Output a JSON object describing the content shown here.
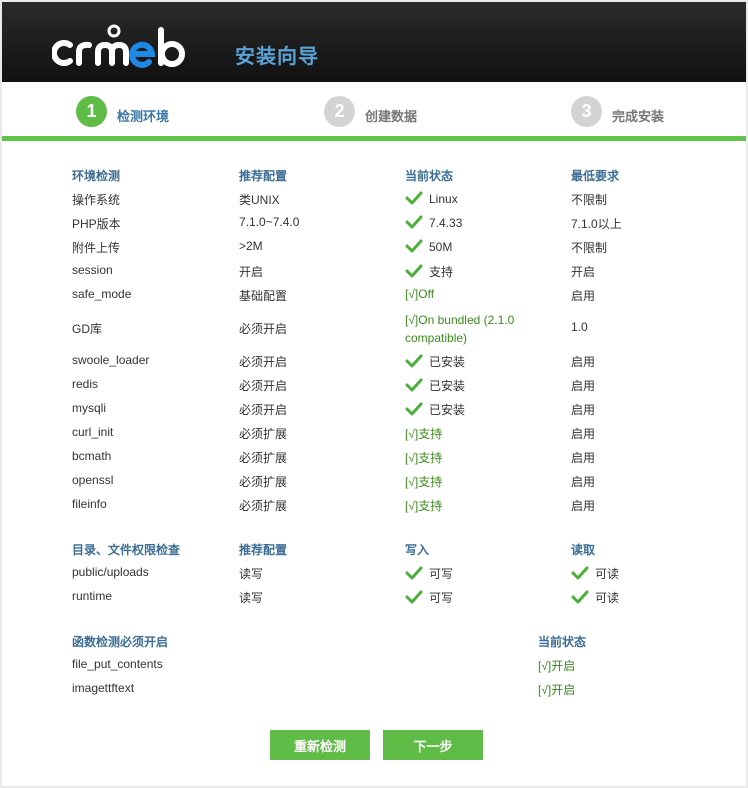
{
  "header": {
    "logo_text": "crmeb",
    "title": "安装向导"
  },
  "steps": [
    {
      "num": "1",
      "label": "检测环境",
      "active": true
    },
    {
      "num": "2",
      "label": "创建数据",
      "active": false
    },
    {
      "num": "3",
      "label": "完成安装",
      "active": false
    }
  ],
  "env": {
    "headers": [
      "环境检测",
      "推荐配置",
      "当前状态",
      "最低要求"
    ],
    "rows": [
      [
        "操作系统",
        "类UNIX",
        "Linux",
        "不限制"
      ],
      [
        "PHP版本",
        "7.1.0~7.4.0",
        "7.4.33",
        "7.1.0以上"
      ],
      [
        "附件上传",
        ">2M",
        "50M",
        "不限制"
      ],
      [
        "session",
        "开启",
        "支持",
        "开启"
      ],
      [
        "safe_mode",
        "基础配置",
        "[√]Off",
        "启用"
      ],
      [
        "GD库",
        "必须开启",
        "[√]On bundled (2.1.0 compatible)",
        "1.0"
      ],
      [
        "swoole_loader",
        "必须开启",
        "已安装",
        "启用"
      ],
      [
        "redis",
        "必须开启",
        "已安装",
        "启用"
      ],
      [
        "mysqli",
        "必须开启",
        "已安装",
        "启用"
      ],
      [
        "curl_init",
        "必须扩展",
        "[√]支持",
        "启用"
      ],
      [
        "bcmath",
        "必须扩展",
        "[√]支持",
        "启用"
      ],
      [
        "openssl",
        "必须扩展",
        "[√]支持",
        "启用"
      ],
      [
        "fileinfo",
        "必须扩展",
        "[√]支持",
        "启用"
      ]
    ]
  },
  "dirs": {
    "headers": [
      "目录、文件权限检查",
      "推荐配置",
      "写入",
      "读取"
    ],
    "rows": [
      [
        "public/uploads",
        "读写",
        "可写",
        "可读"
      ],
      [
        "runtime",
        "读写",
        "可写",
        "可读"
      ]
    ]
  },
  "funcs": {
    "headers": [
      "函数检测必须开启",
      "当前状态"
    ],
    "rows": [
      [
        "file_put_contents",
        "[√]开启"
      ],
      [
        "imagettftext",
        "[√]开启"
      ]
    ]
  },
  "buttons": {
    "recheck": "重新检测",
    "next": "下一步"
  },
  "colors": {
    "accent": "#5fbd47",
    "header_text": "#3d6e95",
    "ok_text": "#3b8b1e",
    "logo_blue": "#1e88e5"
  }
}
